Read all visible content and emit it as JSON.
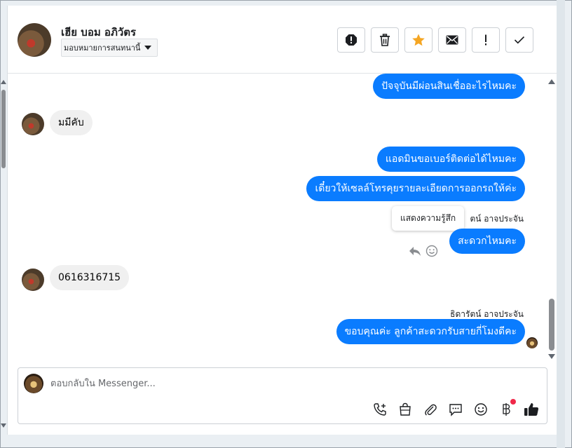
{
  "header": {
    "contact_name": "เฮีย บอม อภิวัตร",
    "assign_label": "มอบหมายการสนทนานี้",
    "actions": [
      "spam-icon",
      "trash-icon",
      "star-icon",
      "mail-icon",
      "important-icon",
      "done-icon"
    ]
  },
  "messages": [
    {
      "direction": "out",
      "text": "ปัจจุบันมีผ่อนสินเชื่ออะไรไหมคะ"
    },
    {
      "direction": "in",
      "text": "มมีคับ"
    },
    {
      "direction": "out",
      "text": "แอดมินขอเบอร์ติดต่อได้ไหมคะ"
    },
    {
      "direction": "out",
      "text": "เดี๋ยวให้เซลล์โทรคุยรายละเอียดการออกรถให้ค่ะ"
    },
    {
      "direction": "out",
      "sender_partial": "ตน์ อาจประจัน",
      "text": "สะดวกไหมคะ"
    },
    {
      "direction": "in",
      "text": "0616316715"
    },
    {
      "direction": "out",
      "sender": "ธิดารัตน์ อาจประจัน",
      "text": "ขอบคุณค่ะ ลูกค้าสะดวกรับสายกี่โมงดีคะ"
    }
  ],
  "tooltip": "แสดงความรู้สึก",
  "composer": {
    "placeholder": "ตอบกลับใน Messenger...",
    "tools": [
      "call-add-icon",
      "shop-bag-icon",
      "attach-icon",
      "saved-reply-icon",
      "emoji-icon",
      "baht-icon",
      "like-icon"
    ],
    "notification_dot_color": "#f02849"
  },
  "colors": {
    "outgoing_bubble": "#0a7cff",
    "incoming_bubble": "#f0f0f0",
    "star_active": "#f5a623"
  }
}
